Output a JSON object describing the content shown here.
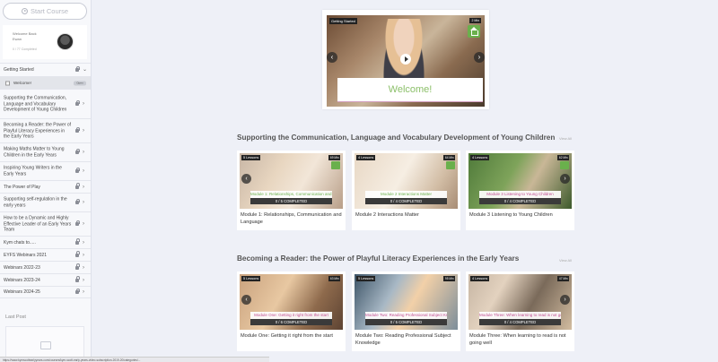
{
  "sidebar": {
    "start_course": "Start Course",
    "welcome_line1": "Welcome Back",
    "welcome_line2": "Ewan",
    "completed": "0 / 77 Completed",
    "menu": [
      {
        "label": "Getting Started",
        "type": "section"
      },
      {
        "label": "Welcome!",
        "type": "sub",
        "badge": "Open"
      },
      {
        "label": "Supporting the Communication, Language and Vocabulary Development of Young Children",
        "type": "section"
      },
      {
        "label": "Becoming a Reader: the Power of Playful Literacy Experiences in the Early Years",
        "type": "section"
      },
      {
        "label": "Making Maths Matter to Young Children in the Early Years",
        "type": "section"
      },
      {
        "label": "Inspiring Young Writers in the Early Years",
        "type": "section"
      },
      {
        "label": "The Power of Play",
        "type": "section"
      },
      {
        "label": "Supporting self-regulation in the early years",
        "type": "section"
      },
      {
        "label": "How to be a Dynamic and Highly Effective Leader of an Early Years Team",
        "type": "section"
      },
      {
        "label": "Kym chats to.....",
        "type": "section"
      },
      {
        "label": "EYFS Webinars 2021",
        "type": "section"
      },
      {
        "label": "Webinars 2022-23",
        "type": "section"
      },
      {
        "label": "Webinars 2023-24",
        "type": "section"
      },
      {
        "label": "Webinars 2024-25",
        "type": "section"
      }
    ],
    "last_post": "Last Post"
  },
  "featured": {
    "tag": "Getting Started",
    "minutes": "2 Min",
    "title": "Welcome!"
  },
  "sections": [
    {
      "title": "Supporting the Communication, Language and Vocabulary Development of Young Children",
      "link": "View All",
      "cards": [
        {
          "lessons": "5 Lessons",
          "mins": "69 Min",
          "thumb_title": "Module 1: Relationships, Communication and Language",
          "progress": "0 / 5 COMPLETED",
          "caption": "Module 1: Relationships, Communication and Language"
        },
        {
          "lessons": "4 Lessons",
          "mins": "64 Min",
          "thumb_title": "Module 2 Interactions Matter",
          "progress": "0 / 4 COMPLETED",
          "caption": "Module 2 Interactions Matter"
        },
        {
          "lessons": "4 Lessons",
          "mins": "62 Min",
          "thumb_title": "Module 3 Listening to Young Children",
          "progress": "0 / 4 COMPLETED",
          "caption": "Module 3 Listening to Young Children"
        }
      ]
    },
    {
      "title": "Becoming a Reader: the Power of Playful Literacy Experiences in the Early Years",
      "link": "View All",
      "cards": [
        {
          "lessons": "5 Lessons",
          "mins": "63 Min",
          "thumb_title": "Module One: Getting it right from the start",
          "progress": "0 / 6 COMPLETED",
          "caption": "Module One: Getting it right from the start"
        },
        {
          "lessons": "5 Lessons",
          "mins": "95 Min",
          "thumb_title": "Module Two: Reading Professional Subject Knowledge",
          "progress": "0 / 5 COMPLETED",
          "caption": "Module Two: Reading Professional Subject Knowledge"
        },
        {
          "lessons": "4 Lessons",
          "mins": "47 Min",
          "thumb_title": "Module Three: When learning to read is not going well",
          "progress": "0 / 4 COMPLETED",
          "caption": "Module Three: When learning to read is not going well"
        }
      ]
    }
  ],
  "status_url": "https://www.kymscottearlyyears.com/courses/kym-scott-early-years-video-subscription-2019-20/categories/..."
}
